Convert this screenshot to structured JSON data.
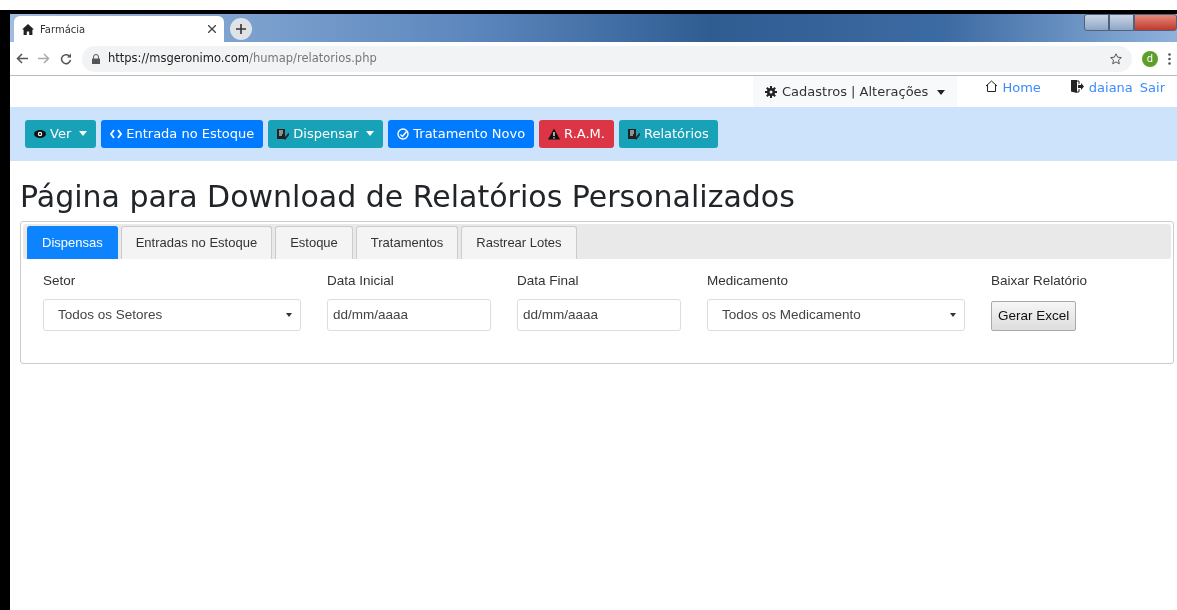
{
  "browser": {
    "tab_title": "Farmácia",
    "url_host": "https://msgeronimo.com",
    "url_path": "/humap/relatorios.php",
    "profile_initial": "d"
  },
  "topnav": {
    "menu": "Cadastros | Alterações",
    "home": "Home",
    "user": "daiana",
    "logout": "Sair"
  },
  "toolbar": [
    {
      "label": "Ver",
      "dropdown": true
    },
    {
      "label": "Entrada no Estoque",
      "dropdown": false
    },
    {
      "label": "Dispensar",
      "dropdown": true
    },
    {
      "label": "Tratamento Novo",
      "dropdown": false
    },
    {
      "label": "R.A.M.",
      "dropdown": false
    },
    {
      "label": "Relatórios",
      "dropdown": false
    }
  ],
  "heading": "Página para Download de Relatórios Personalizados",
  "tabs": [
    {
      "label": "Dispensas",
      "selected": true
    },
    {
      "label": "Entradas no Estoque",
      "selected": false
    },
    {
      "label": "Estoque",
      "selected": false
    },
    {
      "label": "Tratamentos",
      "selected": false
    },
    {
      "label": "Rastrear Lotes",
      "selected": false
    }
  ],
  "filters": [
    {
      "kind": "select",
      "label": "Setor",
      "value": "Todos os Setores"
    },
    {
      "kind": "date",
      "label": "Data Inicial",
      "value": "dd/mm/aaaa"
    },
    {
      "kind": "date",
      "label": "Data Final",
      "value": "dd/mm/aaaa"
    },
    {
      "kind": "select",
      "label": "Medicamento",
      "value": "Todos os Medicamento"
    },
    {
      "kind": "button",
      "label": "Baixar Relatório",
      "value": "Gerar Excel"
    }
  ]
}
